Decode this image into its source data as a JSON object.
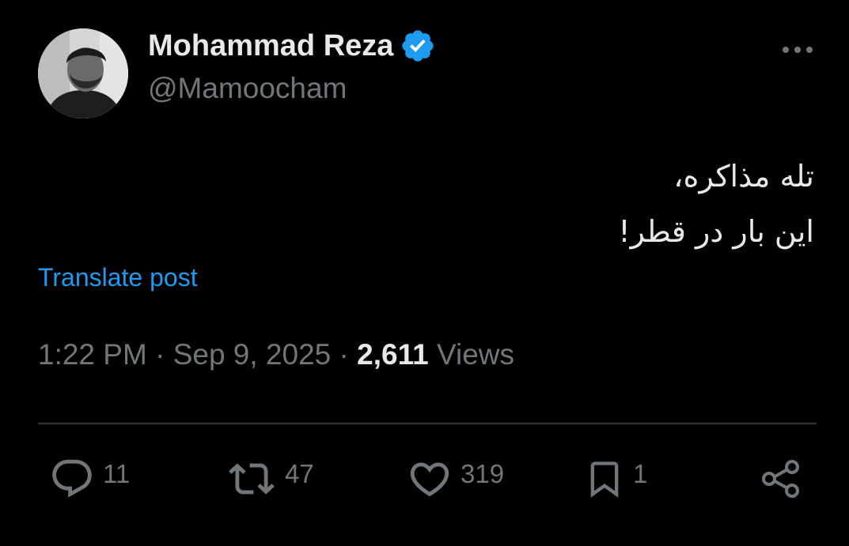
{
  "author": {
    "display_name": "Mohammad Reza",
    "handle": "@Mamoocham",
    "verified": true
  },
  "post": {
    "lines": [
      "تله مذاکره،",
      "این بار در قطر!"
    ],
    "translate_label": "Translate post"
  },
  "meta": {
    "time": "1:22 PM",
    "separator": "·",
    "date": "Sep 9, 2025",
    "views_count": "2,611",
    "views_label": "Views"
  },
  "actions": {
    "replies": "11",
    "reposts": "47",
    "likes": "319",
    "bookmarks": "1"
  },
  "icons": {
    "more": "more-dots-icon",
    "reply": "reply-bubble-icon",
    "repost": "repost-arrows-icon",
    "like": "heart-icon",
    "bookmark": "bookmark-icon",
    "share": "share-nodes-icon",
    "verified": "verified-badge-icon"
  },
  "colors": {
    "background": "#000000",
    "primary_text": "#e7e9ea",
    "secondary_text": "#71767b",
    "link": "#1d9bf0",
    "divider": "#2f3336",
    "verified": "#1d9bf0"
  }
}
